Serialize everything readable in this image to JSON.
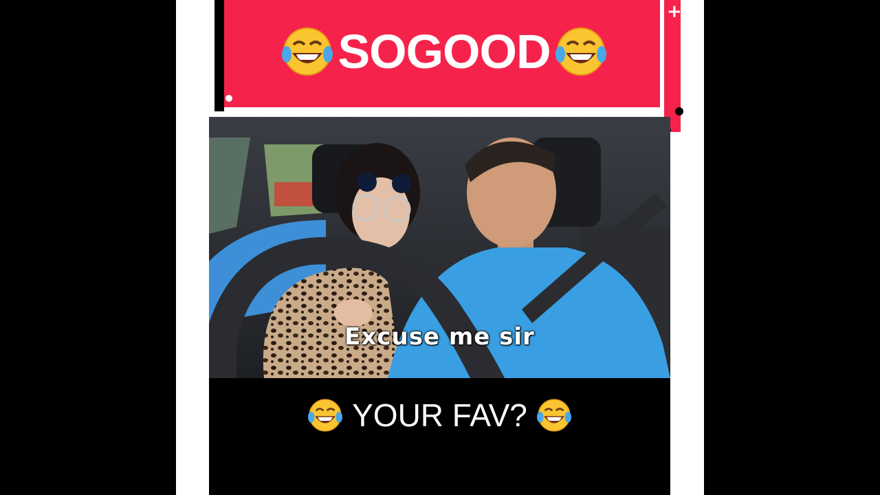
{
  "banner": {
    "title": "SOGOOD",
    "emoji_icon": "tears-of-joy-emoji",
    "color": "#f5234b"
  },
  "video": {
    "subtitle": "Excuse me sir"
  },
  "caption": {
    "text": "YOUR FAV?",
    "emoji_icon": "tears-of-joy-emoji"
  }
}
